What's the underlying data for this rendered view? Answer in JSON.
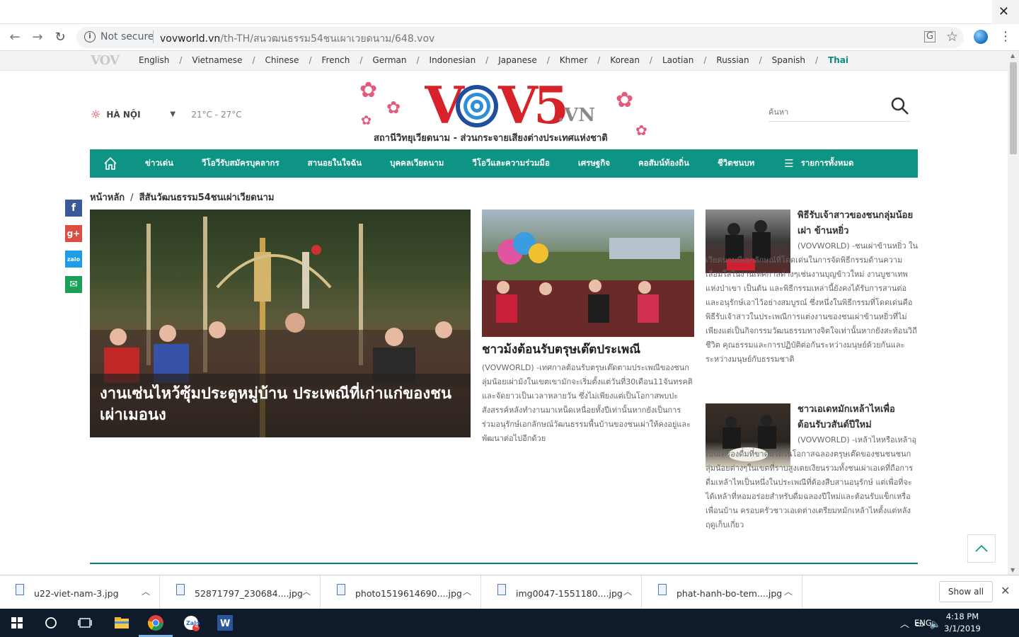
{
  "browser": {
    "security_label": "Not secure",
    "url_host": "vovworld.vn",
    "url_path": "/th-TH/สนวฒนธรรม54ชนเผาเวยดนาม/648.vov"
  },
  "langbar": {
    "logo": "VOV",
    "languages": [
      {
        "label": "English"
      },
      {
        "label": "Vietnamese"
      },
      {
        "label": "Chinese"
      },
      {
        "label": "French"
      },
      {
        "label": "German"
      },
      {
        "label": "Indonesian"
      },
      {
        "label": "Japanese"
      },
      {
        "label": "Khmer"
      },
      {
        "label": "Korean"
      },
      {
        "label": "Laotian"
      },
      {
        "label": "Russian"
      },
      {
        "label": "Spanish"
      },
      {
        "label": "Thai",
        "active": true
      }
    ]
  },
  "header": {
    "weather_city": "HÀ NỘI",
    "weather_dropdown": "▼",
    "weather_temp": "21°C - 27°C",
    "logo_main": "VOV5",
    "logo_suffix": ".VN",
    "slogan": "สถานีวิทยุเวียดนาม - ส่วนกระจายเสียงต่างประเทศแห่งชาติ",
    "search_placeholder": "ค้นหา"
  },
  "nav": {
    "items": [
      "ข่าวเด่น",
      "วีโอวีรับสมัครบุคลากร",
      "สานอยในใจฉัน",
      "บุคคลเวียดนาม",
      "วีโอวีและความร่วมมือ",
      "เศรษฐกิจ",
      "คอสัมน์ท้องถิ่น",
      "ชีวิตชนบท"
    ],
    "all_label": "รายการทั้งหมด"
  },
  "breadcrumb": {
    "home": "หน้าหลัก",
    "sep": "/",
    "current": "สีสันวัฒนธรรม54ชนเผ่าเวียดนาม"
  },
  "feature": {
    "title": "งานเซ่นไหว้ซุ้มประตูหมู่บ้าน ประเพณีที่เก่าแก่ของชนเผ่าเมอนง"
  },
  "middle_article": {
    "title": "ชาวม้งต้อนรับตรุษเต๊ตประเพณี",
    "desc": "(VOVWORLD) -เทศกาลต้อนรับตรุษเต๊ดตามประเพณีของชนกลุ่มน้อยเผ่าม้งในเขตเขามักจะเริ่มตั้งแต่วันที่30เดือน11จันทรคติและจัดยาวเป็นเวลาหลายวัน ซึ่งไม่เพียงแต่เป็นโอกาสพบปะสังสรรค์หลังทำงานมาเหน็ดเหนื่อยทั้งปีเท่านั้นหากยังเป็นการร่วมอนุรักษ์เอกลักษณ์วัฒนธรรมพื้นบ้านของชนเผ่าให้คงอยู่และพัฒนาต่อไปอีกด้วย"
  },
  "right_articles": [
    {
      "title": "พิธีรับเจ้าสาวของชนกลุ่มน้อยเผ่า ข้านหยิ่ว",
      "desc": "(VOVWORLD) -ชนเผ่าข้านหยิ่ว ในเวียดนามมีเอกลักษณ์ที่โดดเด่นในการจัดพิธีกรรมด้านความเลื่อมใสในงานเทศกาลต่างๆเช่นงานบุญข้าวใหม่ งานบูชาเทพแห่งป่าเขา เป็นต้น และพิธีกรรมเหล่านี้ยังคงได้รับการสานต่อและอนุรักษ์เอาไว้อย่างสมบูรณ์ ซึ่งหนึ่งในพิธีกรรมที่โดดเด่นคือพิธีรับเจ้าสาวในประเพณีการแต่งงานของชนเผ่าข้านหยิ่วที่ไม่เพียงแต่เป็นกิจกรรมวัฒนธรรมทางจิตใจเท่านั้นหากยังสะท้อนวิถีชีวิต คุณธรรมและการปฏิบัติต่อกันระหว่างมนุษย์ด้วยกันและระหว่างมนุษย์กับธรรมชาติ"
    },
    {
      "title": "ชาวเอเดหมักเหล้าไหเพื่อต้อนรับวสันต์ปีใหม่",
      "desc": "(VOVWORLD) -เหล้าไหหรือเหล้าอุเป็นเครื่องดื่มที่ขาดมิได้ในโอกาสฉลองตรุษเต๊ดของชนชนชนกลุ่มน้อยต่างๆในเขตที่ราบสูงเตยเงียนรวมทั้งชนเผ่าเอเดที่ถือการดื่มเหล้าไหเป็นหนึ่งในประเพณีที่ต้องสืบสานอนุรักษ์ แต่เพื่อที่จะได้เหล้าที่หอมอร่อยสำหรับดื่มฉลองปีใหม่และต้อนรับแข็กเหรื่อเพื่อนบ้าน ครอบครัวชาวเอเดต่างเตรียมหมักเหล้าไหตั้งแต่หลังฤดูเก็บเกี่ยว"
    }
  ],
  "downloads": {
    "items": [
      {
        "name": "u22-viet-nam-3.jpg"
      },
      {
        "name": "52871797_230684....jpg"
      },
      {
        "name": "photo1519614690....jpg"
      },
      {
        "name": "img0047-1551180....jpg"
      },
      {
        "name": "phat-hanh-bo-tem....jpg"
      }
    ],
    "show_all": "Show all"
  },
  "taskbar": {
    "time": "4:18 PM",
    "date": "3/1/2019",
    "lang": "ENG",
    "zalo_badge": "4"
  },
  "colors": {
    "accent": "#0e9484",
    "logo_red": "#d7222a",
    "logo_blue": "#1f4e9b"
  }
}
